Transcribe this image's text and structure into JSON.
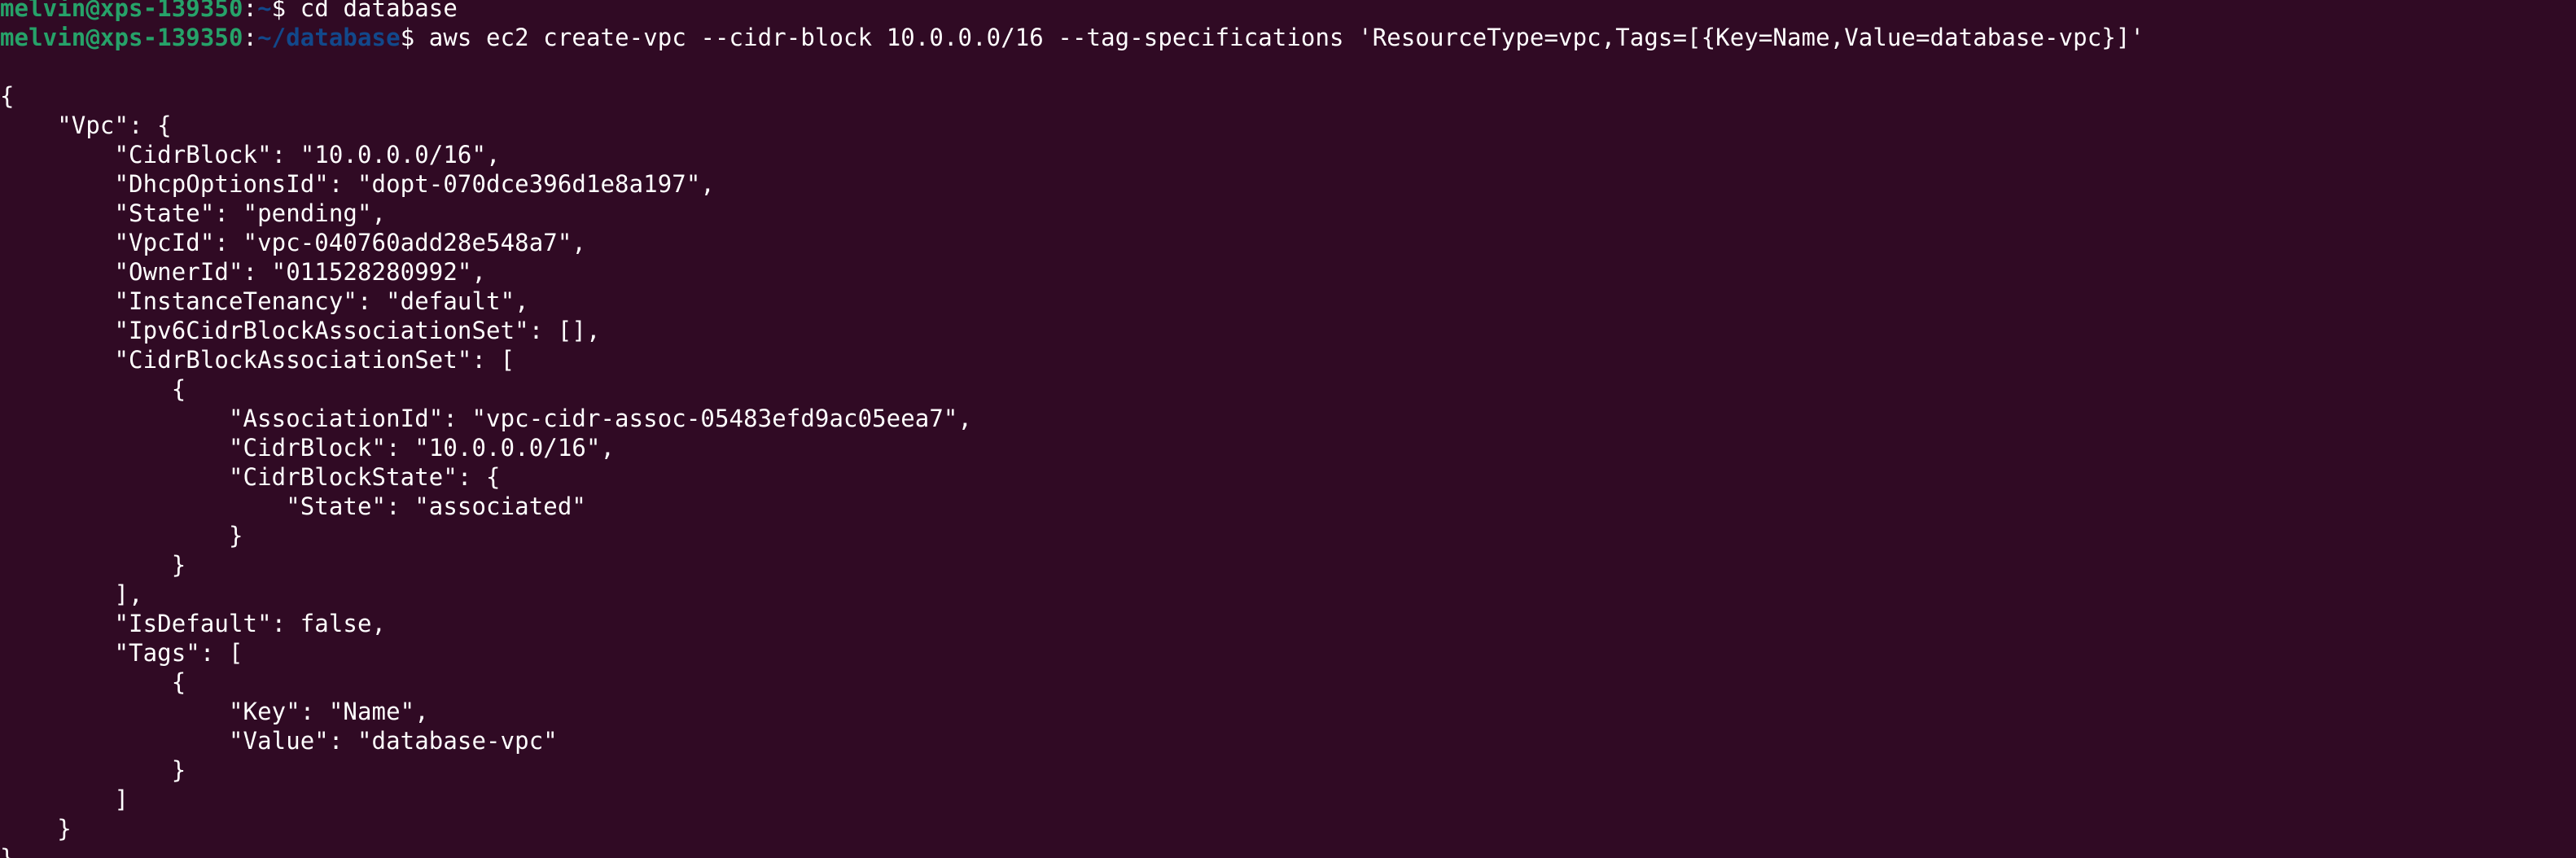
{
  "terminal": {
    "background": "#300a24",
    "prompt_user_color": "#26a269",
    "prompt_path_color": "#12488b",
    "text_color": "#ffffff",
    "history": {
      "user_host": "melvin@xps-139350",
      "colon": ":",
      "path": "~",
      "dollar": "$",
      "command": " cd database"
    },
    "current": {
      "user_host": "melvin@xps-139350",
      "colon": ":",
      "path": "~/database",
      "dollar": "$",
      "command": " aws ec2 create-vpc --cidr-block 10.0.0.0/16 --tag-specifications 'ResourceType=vpc,Tags=[{Key=Name,Value=database-vpc}]'"
    },
    "output_lines": [
      "",
      "{",
      "    \"Vpc\": {",
      "        \"CidrBlock\": \"10.0.0.0/16\",",
      "        \"DhcpOptionsId\": \"dopt-070dce396d1e8a197\",",
      "        \"State\": \"pending\",",
      "        \"VpcId\": \"vpc-040760add28e548a7\",",
      "        \"OwnerId\": \"011528280992\",",
      "        \"InstanceTenancy\": \"default\",",
      "        \"Ipv6CidrBlockAssociationSet\": [],",
      "        \"CidrBlockAssociationSet\": [",
      "            {",
      "                \"AssociationId\": \"vpc-cidr-assoc-05483efd9ac05eea7\",",
      "                \"CidrBlock\": \"10.0.0.0/16\",",
      "                \"CidrBlockState\": {",
      "                    \"State\": \"associated\"",
      "                }",
      "            }",
      "        ],",
      "        \"IsDefault\": false,",
      "        \"Tags\": [",
      "            {",
      "                \"Key\": \"Name\",",
      "                \"Value\": \"database-vpc\"",
      "            }",
      "        ]",
      "    }",
      "}"
    ]
  }
}
